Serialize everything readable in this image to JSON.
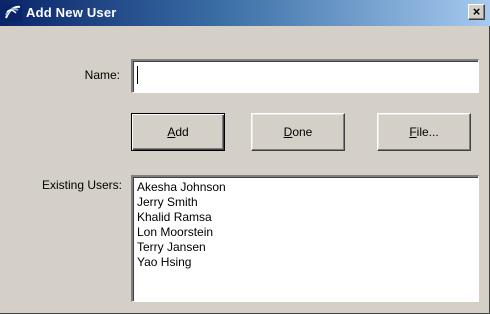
{
  "window": {
    "title": "Add New User",
    "close_glyph": "×"
  },
  "form": {
    "name_label": "Name:",
    "name_value": "",
    "existing_users_label": "Existing Users:"
  },
  "buttons": {
    "add": {
      "accel": "A",
      "rest": "dd"
    },
    "done": {
      "accel": "D",
      "rest": "one"
    },
    "file": {
      "accel": "F",
      "rest": "ile..."
    }
  },
  "existing_users": [
    "Akesha Johnson",
    "Jerry Smith",
    "Khalid Ramsa",
    "Lon Moorstein",
    "Terry Jansen",
    "Yao Hsing"
  ],
  "icons": {
    "app": "app-icon",
    "close": "close-icon"
  }
}
